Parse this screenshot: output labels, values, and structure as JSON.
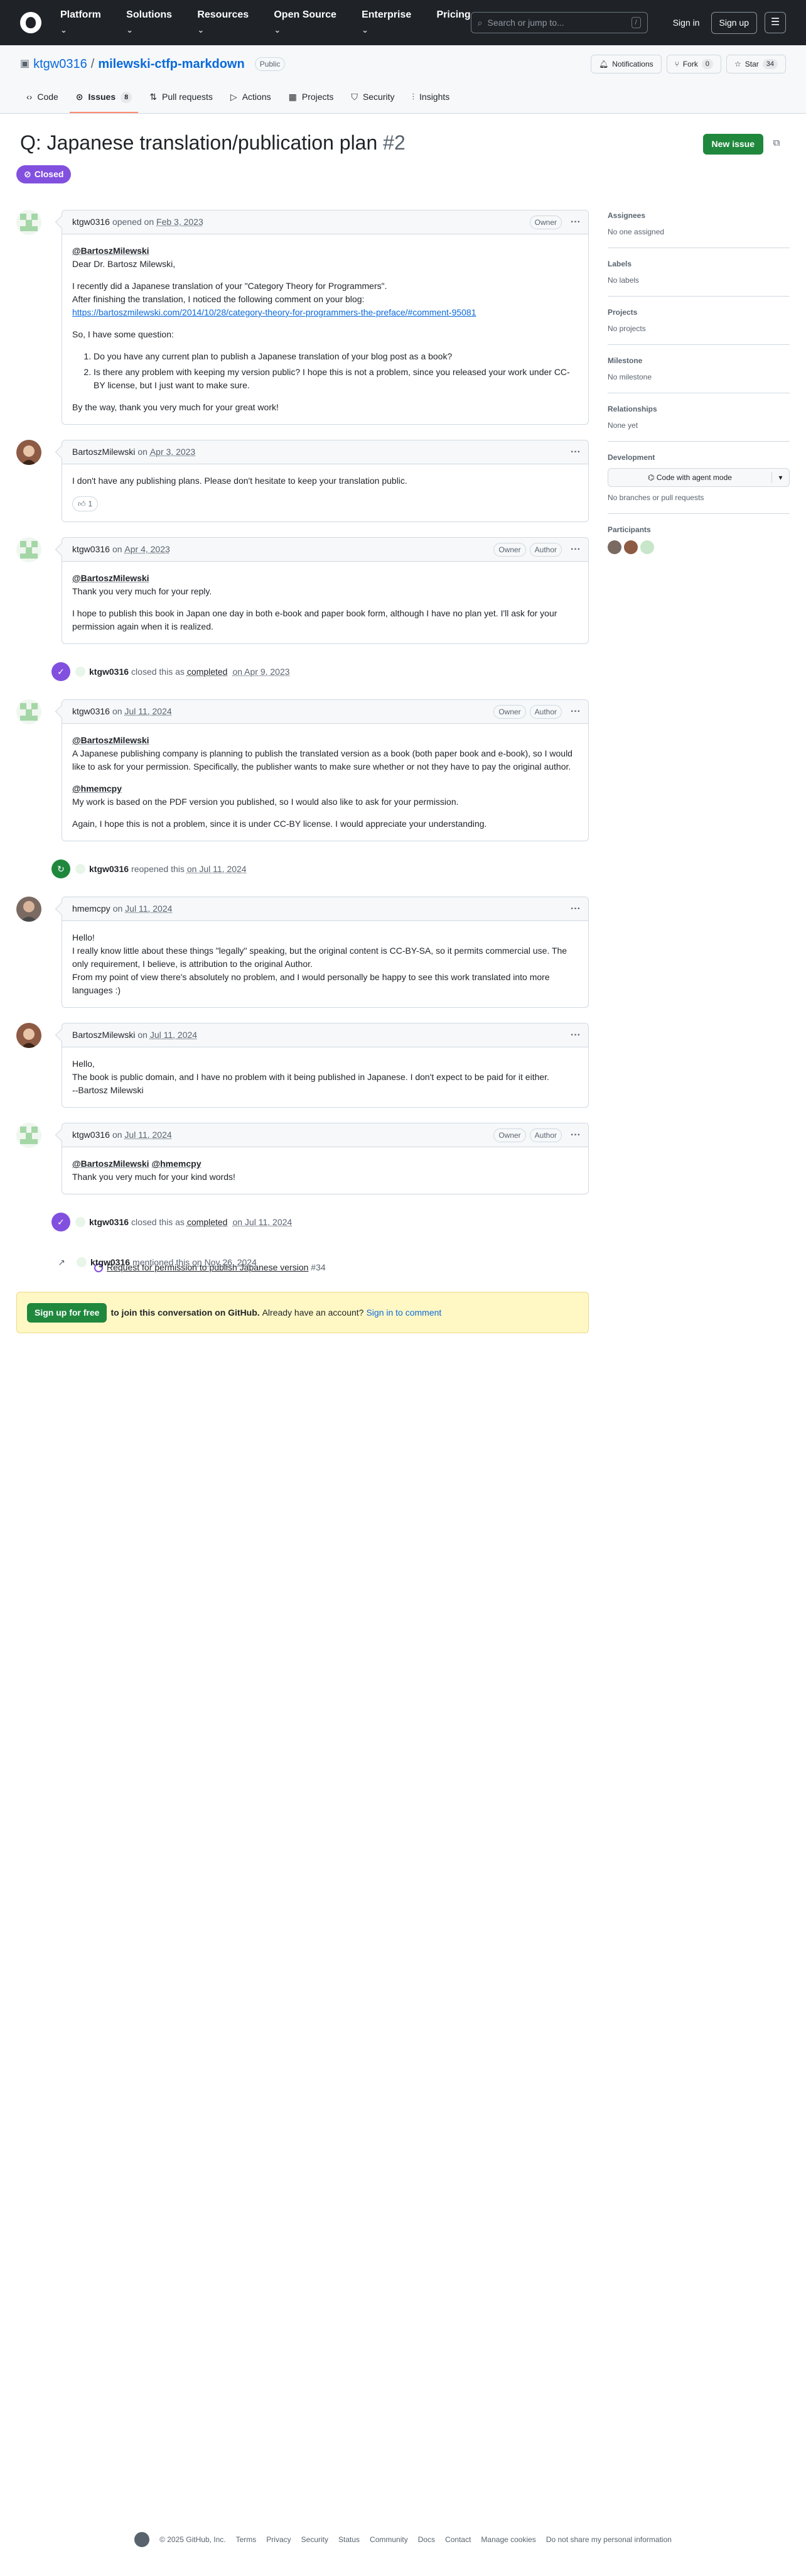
{
  "header": {
    "nav": [
      "Platform",
      "Solutions",
      "Resources",
      "Open Source",
      "Enterprise",
      "Pricing"
    ],
    "search_placeholder": "Search or jump to...",
    "search_key": "/",
    "sign_in": "Sign in",
    "sign_up": "Sign up"
  },
  "repo": {
    "owner": "ktgw0316",
    "name": "milewski-ctfp-markdown",
    "visibility": "Public",
    "notifications": "Notifications",
    "fork_label": "Fork",
    "fork_count": "0",
    "star_label": "Star",
    "star_count": "34",
    "tabs": [
      {
        "label": "Code"
      },
      {
        "label": "Issues",
        "count": "8"
      },
      {
        "label": "Pull requests"
      },
      {
        "label": "Actions"
      },
      {
        "label": "Projects"
      },
      {
        "label": "Security"
      },
      {
        "label": "Insights"
      }
    ]
  },
  "issue": {
    "title": "Q: Japanese translation/publication plan",
    "number": "#2",
    "state": "Closed",
    "new_issue": "New issue"
  },
  "comments": [
    {
      "author": "ktgw0316",
      "verb": "opened on",
      "time": "Feb 3, 2023",
      "badges": [
        "Owner"
      ],
      "mention": "@BartoszMilewski",
      "greeting": "Dear Dr. Bartosz Milewski,",
      "p1": "I recently did a Japanese translation of your \"Category Theory for Programmers\".",
      "p2": "After finishing the translation, I noticed the following comment on your blog:",
      "link": "https://bartoszmilewski.com/2014/10/28/category-theory-for-programmers-the-preface/#comment-95081",
      "q_intro": "So, I have some question:",
      "q1": "Do you have any current plan to publish a Japanese translation of your blog post as a book?",
      "q2": "Is there any problem with keeping my version public? I hope this is not a problem, since you released your work under CC-BY license, but I just want to make sure.",
      "closing": "By the way, thank you very much for your great work!"
    },
    {
      "author": "BartoszMilewski",
      "verb": "on",
      "time": "Apr 3, 2023",
      "badges": [],
      "text": "I don't have any publishing plans. Please don't hesitate to keep your translation public.",
      "reaction": "1"
    },
    {
      "author": "ktgw0316",
      "verb": "on",
      "time": "Apr 4, 2023",
      "badges": [
        "Owner",
        "Author"
      ],
      "mention": "@BartoszMilewski",
      "l1": "Thank you very much for your reply.",
      "l2": "I hope to publish this book in Japan one day in both e-book and paper book form, although I have no plan yet. I'll ask for your permission again when it is realized."
    },
    {
      "author": "ktgw0316",
      "verb": "on",
      "time": "Jul 11, 2024",
      "badges": [
        "Owner",
        "Author"
      ],
      "mention": "@BartoszMilewski",
      "l1": "A Japanese publishing company is planning to publish the translated version as a book (both paper book and e-book), so I would like to ask for your permission. Specifically, the publisher wants to make sure whether or not they have to pay the original author.",
      "mention2": "@hmemcpy",
      "l2": "My work is based on the PDF version you published, so I would also like to ask for your permission.",
      "l3": "Again, I hope this is not a problem, since it is under CC-BY license. I would appreciate your understanding."
    },
    {
      "author": "hmemcpy",
      "verb": "on",
      "time": "Jul 11, 2024",
      "badges": [],
      "l0": "Hello!",
      "l1": "I really know little about these things \"legally\" speaking, but the original content is CC-BY-SA, so it permits commercial use. The only requirement, I believe, is attribution to the original Author.",
      "l2": "From my point of view there's absolutely no problem, and I would personally be happy to see this work translated into more languages :)"
    },
    {
      "author": "BartoszMilewski",
      "verb": "on",
      "time": "Jul 11, 2024",
      "badges": [],
      "l0": "Hello,",
      "l1": "The book is public domain, and I have no problem with it being published in Japanese. I don't expect to be paid for it either.",
      "l2": "--Bartosz Milewski"
    },
    {
      "author": "ktgw0316",
      "verb": "on",
      "time": "Jul 11, 2024",
      "badges": [
        "Owner",
        "Author"
      ],
      "mention": "@BartoszMilewski",
      "mention2": "@hmemcpy",
      "l1": "Thank you very much for your kind words!"
    }
  ],
  "events": [
    {
      "user": "ktgw0316",
      "pre": "closed this as",
      "link": "completed",
      "time": "on Apr 9, 2023"
    },
    {
      "user": "ktgw0316",
      "pre": "reopened this",
      "link": "",
      "time": "on Jul 11, 2024"
    },
    {
      "user": "ktgw0316",
      "pre": "closed this as",
      "link": "completed",
      "time": "on Jul 11, 2024"
    },
    {
      "user": "ktgw0316",
      "pre": "mentioned this",
      "link": "",
      "time": "on Nov 26, 2024",
      "xref_title": "Request for permission to publish Japanese version",
      "xref_num": "#34"
    }
  ],
  "signup": {
    "button": "Sign up for free",
    "bold": "to join this conversation on GitHub.",
    "plain": "Already have an account?",
    "link": "Sign in to comment"
  },
  "sidebar": {
    "assignees": "Assignees",
    "assignees_v": "No one assigned",
    "labels": "Labels",
    "labels_v": "No labels",
    "projects": "Projects",
    "projects_v": "No projects",
    "milestone": "Milestone",
    "milestone_v": "No milestone",
    "relationships": "Relationships",
    "relationships_v": "None yet",
    "development": "Development",
    "dev_button": "Code with agent mode",
    "dev_v": "No branches or pull requests",
    "participants": "Participants"
  },
  "footer": {
    "copyright": "© 2025 GitHub, Inc.",
    "links": [
      "Terms",
      "Privacy",
      "Security",
      "Status",
      "Community",
      "Docs",
      "Contact",
      "Manage cookies",
      "Do not share my personal information"
    ]
  },
  "colors": {
    "closed": "#8250df",
    "open": "#1f883d",
    "link": "#0969da"
  }
}
